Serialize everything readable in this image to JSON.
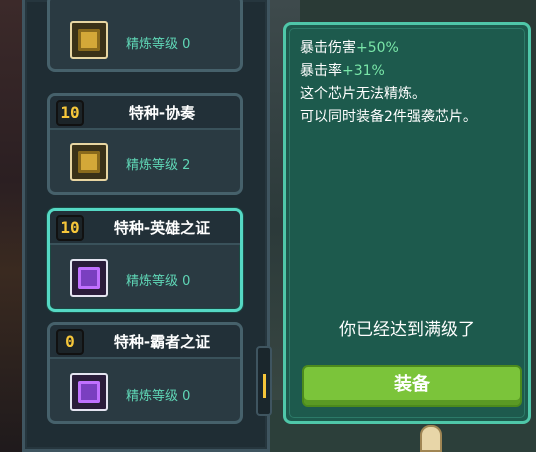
{
  "chips": [
    {
      "level": "",
      "name": "",
      "refine": "精炼等级 0",
      "icon": "gold-chip-icon"
    },
    {
      "level": "10",
      "name": "特种-协奏",
      "refine": "精炼等级 2",
      "icon": "gold-chip-icon"
    },
    {
      "level": "10",
      "name": "特种-英雄之证",
      "refine": "精炼等级 0",
      "icon": "purple-chip-icon",
      "selected": true
    },
    {
      "level": "0",
      "name": "特种-霸者之证",
      "refine": "精炼等级 0",
      "icon": "purple-chip-icon"
    }
  ],
  "detail": {
    "crit_damage_label": "暴击伤害",
    "crit_damage_value": "+50%",
    "crit_rate_label": "暴击率",
    "crit_rate_value": "+31%",
    "note1": "这个芯片无法精炼。",
    "note2": "可以同时装备2件强袭芯片。",
    "maxed": "你已经达到满级了",
    "equip_label": "装备"
  },
  "colors": {
    "accent": "#4fc7a9",
    "level_badge": "#f6c63a",
    "refine_text": "#5fd6b6",
    "equip_button": "#7bc43a"
  }
}
